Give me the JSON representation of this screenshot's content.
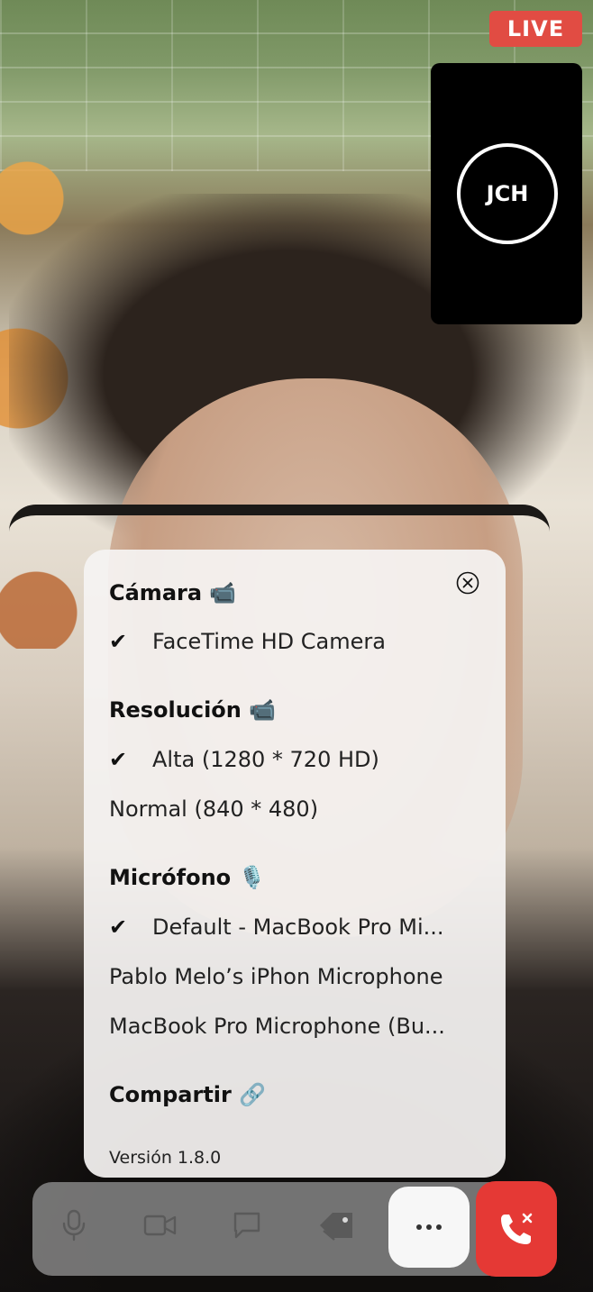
{
  "status": {
    "live_label": "LIVE"
  },
  "self_preview": {
    "initials": "JCH"
  },
  "settings": {
    "camera": {
      "title": "Cámara 📹",
      "options": [
        {
          "label": "FaceTime HD Camera",
          "selected": true
        }
      ]
    },
    "resolution": {
      "title": "Resolución 📹",
      "options": [
        {
          "label": "Alta (1280 * 720 HD)",
          "selected": true
        },
        {
          "label": "Normal (840 * 480)",
          "selected": false
        }
      ]
    },
    "microphone": {
      "title": "Micrófono 🎙️",
      "options": [
        {
          "label": "Default - MacBook Pro Mi...",
          "selected": true
        },
        {
          "label": "Pablo Melo’s iPhon Microphone",
          "selected": false
        },
        {
          "label": "MacBook Pro Microphone (Bu...",
          "selected": false
        }
      ]
    },
    "share": {
      "title": "Compartir 🔗"
    },
    "version": "Versión 1.8.0",
    "check_glyph": "✔"
  },
  "controls": {
    "icons": [
      "microphone-icon",
      "video-camera-icon",
      "chat-icon",
      "tag-icon",
      "more-icon",
      "end-call-icon"
    ],
    "colors": {
      "end_call": "#e53935",
      "live": "#e14c43"
    }
  }
}
